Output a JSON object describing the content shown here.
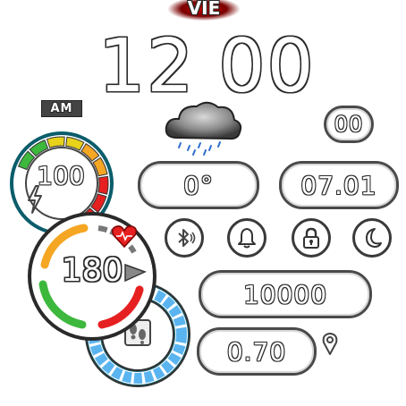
{
  "header": {
    "day": "VIE",
    "time_hours": "12",
    "time_minutes": "00",
    "ampm": "AM"
  },
  "weather": {
    "icon": "rain-cloud-icon",
    "seconds": "00",
    "temperature": "0°",
    "date": "07.01"
  },
  "battery": {
    "level": 100,
    "label": "100",
    "icon": "lightning-icon"
  },
  "heart_rate": {
    "value": "180",
    "icon": "heart-icon"
  },
  "status_icons": [
    "bluetooth-icon",
    "bell-icon",
    "lock-icon",
    "moon-icon"
  ],
  "steps": {
    "value": "10000",
    "icon": "footprints-icon"
  },
  "distance": {
    "value": "0.70",
    "icon": "location-pin-icon"
  },
  "colors": {
    "gauge_red": "#e62020",
    "gauge_orange": "#f5a623",
    "gauge_yellow": "#e8d21a",
    "gauge_green": "#3db83d",
    "gauge_blue": "#5ab4f0",
    "gauge_teal": "#0b5d6b"
  }
}
